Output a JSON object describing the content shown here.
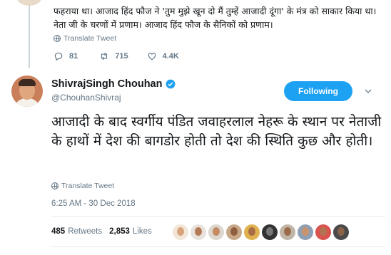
{
  "previous_tweet": {
    "text": "फहराया था। आजाद हिंद फौज ने 'तुम मुझे खून दो मैं तुम्हें आजादी दूंगा' के मंत्र को साकार किया था। नेता जी के चरणों में प्रणाम। आजाद हिंद फौज के सैनिकों को प्रणाम।",
    "translate_label": "Translate Tweet",
    "replies": "81",
    "retweets": "715",
    "likes": "4.4K"
  },
  "tweet": {
    "author_name": "ShivrajSingh Chouhan",
    "handle": "@ChouhanShivraj",
    "follow_label": "Following",
    "text": "आजादी के बाद स्वर्गीय पंडित जवाहरलाल नेहरू के स्थान पर नेताजी के हाथों में देश की बागडोर होती तो देश की स्थिति कुछ और होती।",
    "translate_label": "Translate Tweet",
    "timestamp": "6:25 AM - 30 Dec 2018",
    "retweet_count": "485",
    "retweet_label": "Retweets",
    "like_count": "2,853",
    "like_label": "Likes"
  },
  "colors": {
    "accent": "#1da1f2",
    "muted": "#657786",
    "text": "#14171a"
  },
  "liker_avatars": [
    "avatar-1",
    "avatar-2",
    "avatar-3",
    "avatar-4",
    "avatar-5",
    "avatar-6",
    "avatar-7",
    "avatar-8",
    "avatar-9",
    "avatar-10"
  ]
}
